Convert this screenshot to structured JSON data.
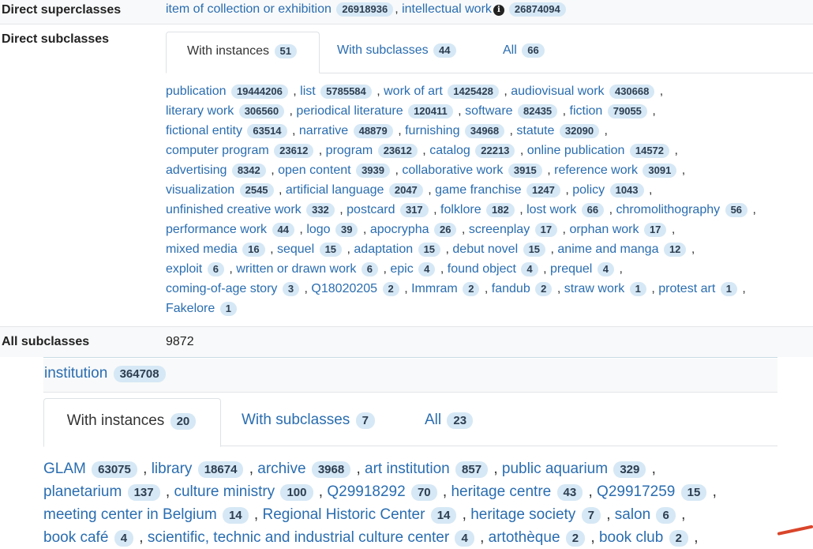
{
  "superclasses": {
    "label": "Direct superclasses",
    "items": [
      {
        "name": "item of collection or exhibition",
        "count": "26918936"
      },
      {
        "name": "intellectual work",
        "count": "26874094"
      }
    ]
  },
  "subclasses": {
    "label": "Direct subclasses",
    "tabs": [
      {
        "label": "With instances",
        "count": "51"
      },
      {
        "label": "With subclasses",
        "count": "44"
      },
      {
        "label": "All",
        "count": "66"
      }
    ],
    "items": [
      {
        "name": "publication",
        "count": "19444206"
      },
      {
        "name": "list",
        "count": "5785584"
      },
      {
        "name": "work of art",
        "count": "1425428"
      },
      {
        "name": "audiovisual work",
        "count": "430668"
      },
      {
        "name": "literary work",
        "count": "306560"
      },
      {
        "name": "periodical literature",
        "count": "120411"
      },
      {
        "name": "software",
        "count": "82435"
      },
      {
        "name": "fiction",
        "count": "79055"
      },
      {
        "name": "fictional entity",
        "count": "63514"
      },
      {
        "name": "narrative",
        "count": "48879"
      },
      {
        "name": "furnishing",
        "count": "34968"
      },
      {
        "name": "statute",
        "count": "32090"
      },
      {
        "name": "computer program",
        "count": "23612"
      },
      {
        "name": "program",
        "count": "23612"
      },
      {
        "name": "catalog",
        "count": "22213"
      },
      {
        "name": "online publication",
        "count": "14572"
      },
      {
        "name": "advertising",
        "count": "8342"
      },
      {
        "name": "open content",
        "count": "3939"
      },
      {
        "name": "collaborative work",
        "count": "3915"
      },
      {
        "name": "reference work",
        "count": "3091"
      },
      {
        "name": "visualization",
        "count": "2545"
      },
      {
        "name": "artificial language",
        "count": "2047"
      },
      {
        "name": "game franchise",
        "count": "1247"
      },
      {
        "name": "policy",
        "count": "1043"
      },
      {
        "name": "unfinished creative work",
        "count": "332"
      },
      {
        "name": "postcard",
        "count": "317"
      },
      {
        "name": "folklore",
        "count": "182"
      },
      {
        "name": "lost work",
        "count": "66"
      },
      {
        "name": "chromolithography",
        "count": "56"
      },
      {
        "name": "performance work",
        "count": "44"
      },
      {
        "name": "logo",
        "count": "39"
      },
      {
        "name": "apocrypha",
        "count": "26"
      },
      {
        "name": "screenplay",
        "count": "17"
      },
      {
        "name": "orphan work",
        "count": "17"
      },
      {
        "name": "mixed media",
        "count": "16"
      },
      {
        "name": "sequel",
        "count": "15"
      },
      {
        "name": "adaptation",
        "count": "15"
      },
      {
        "name": "debut novel",
        "count": "15"
      },
      {
        "name": "anime and manga",
        "count": "12"
      },
      {
        "name": "exploit",
        "count": "6"
      },
      {
        "name": "written or drawn work",
        "count": "6"
      },
      {
        "name": "epic",
        "count": "4"
      },
      {
        "name": "found object",
        "count": "4"
      },
      {
        "name": "prequel",
        "count": "4"
      },
      {
        "name": "coming-of-age story",
        "count": "3"
      },
      {
        "name": "Q18020205",
        "count": "2"
      },
      {
        "name": "Immram",
        "count": "2"
      },
      {
        "name": "fandub",
        "count": "2"
      },
      {
        "name": "straw work",
        "count": "1"
      },
      {
        "name": "protest art",
        "count": "1"
      },
      {
        "name": "Fakelore",
        "count": "1"
      }
    ]
  },
  "all_subclasses": {
    "label": "All subclasses",
    "value": "9872"
  },
  "institution": {
    "title": "institution",
    "count": "364708",
    "tabs": [
      {
        "label": "With instances",
        "count": "20"
      },
      {
        "label": "With subclasses",
        "count": "7"
      },
      {
        "label": "All",
        "count": "23"
      }
    ],
    "items": [
      {
        "name": "GLAM",
        "count": "63075"
      },
      {
        "name": "library",
        "count": "18674"
      },
      {
        "name": "archive",
        "count": "3968"
      },
      {
        "name": "art institution",
        "count": "857"
      },
      {
        "name": "public aquarium",
        "count": "329"
      },
      {
        "name": "planetarium",
        "count": "137"
      },
      {
        "name": "culture ministry",
        "count": "100"
      },
      {
        "name": "Q29918292",
        "count": "70"
      },
      {
        "name": "heritage centre",
        "count": "43"
      },
      {
        "name": "Q29917259",
        "count": "15"
      },
      {
        "name": "meeting center in Belgium",
        "count": "14"
      },
      {
        "name": "Regional Historic Center",
        "count": "14"
      },
      {
        "name": "heritage society",
        "count": "7"
      },
      {
        "name": "salon",
        "count": "6"
      },
      {
        "name": "book café",
        "count": "4"
      },
      {
        "name": "scientific, technic and industrial culture center",
        "count": "4"
      },
      {
        "name": "artothèque",
        "count": "2"
      },
      {
        "name": "book club",
        "count": "2"
      }
    ]
  },
  "colors": {
    "link": "#2a6db0",
    "badge_bg": "#d6e8f5",
    "row_bg": "#f8f9fa"
  }
}
